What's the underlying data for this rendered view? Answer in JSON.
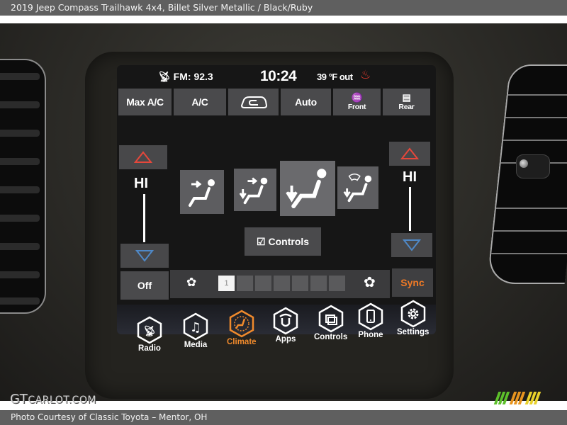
{
  "header": {
    "title": "2019 Jeep Compass Trailhawk 4x4,  Billet Silver Metallic / Black/Ruby"
  },
  "footer": {
    "credit": "Photo Courtesy of Classic Toyota – Mentor, OH"
  },
  "watermark": {
    "brand_big": "GT",
    "brand_small": "CARLOT.COM"
  },
  "status_bar": {
    "radio_icon": "antenna-icon",
    "radio": "FM: 92.3",
    "time": "10:24",
    "outside_temp": "39 °F out",
    "seat_heat_icon": "heated-seat-icon"
  },
  "top_buttons": [
    {
      "label": "Max A/C"
    },
    {
      "label": "A/C"
    },
    {
      "label": "",
      "icon": "recirculation-car-icon"
    },
    {
      "label": "Auto"
    },
    {
      "label": "Front",
      "icon": "front-defrost-icon"
    },
    {
      "label": "Rear",
      "icon": "rear-defrost-icon"
    }
  ],
  "driver_temp": {
    "value": "HI",
    "up_icon": "temp-up-triangle-icon",
    "down_icon": "temp-down-triangle-icon"
  },
  "passenger_temp": {
    "value": "HI",
    "up_icon": "temp-up-triangle-icon",
    "down_icon": "temp-down-triangle-icon"
  },
  "air_modes": [
    {
      "name": "panel",
      "icon": "airflow-panel-icon"
    },
    {
      "name": "bi-level",
      "icon": "airflow-bilevel-icon"
    },
    {
      "name": "floor",
      "icon": "airflow-floor-icon",
      "selected": true
    },
    {
      "name": "defrost-floor",
      "icon": "airflow-defrost-floor-icon"
    }
  ],
  "controls_button": {
    "label": "Controls"
  },
  "fan": {
    "off_label": "Off",
    "level": 1,
    "max_level": 7,
    "level_label": "1",
    "sync_label": "Sync"
  },
  "dock": [
    {
      "label": "Radio",
      "icon": "radio-icon"
    },
    {
      "label": "Media",
      "icon": "music-note-icon"
    },
    {
      "label": "Climate",
      "icon": "climate-icon",
      "active": true
    },
    {
      "label": "Apps",
      "icon": "apps-icon"
    },
    {
      "label": "Controls",
      "icon": "controls-icon"
    },
    {
      "label": "Phone",
      "icon": "phone-icon"
    },
    {
      "label": "Settings",
      "icon": "gear-icon"
    }
  ],
  "colors": {
    "accent_orange": "#f08a2c",
    "temp_up_red": "#e5473b",
    "temp_down_blue": "#4f88c6",
    "heated_seat_red": "#e23a2e"
  }
}
